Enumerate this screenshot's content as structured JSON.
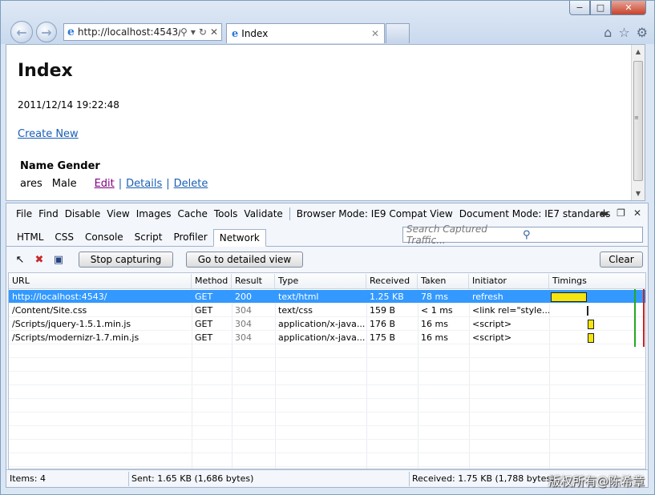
{
  "browser": {
    "address": "http://localhost:4543/",
    "tab_title": "Index",
    "window_controls": {
      "minimize": "−",
      "maximize": "□",
      "close": "✕"
    }
  },
  "page": {
    "title": "Index",
    "date": "2011/12/14 19:22:48",
    "create_link": "Create New",
    "table_header": "Name Gender",
    "row": {
      "name": "ares",
      "gender": "Male",
      "edit": "Edit",
      "details": "Details",
      "delete": "Delete",
      "sep": "|"
    }
  },
  "devtools": {
    "menu": [
      "File",
      "Find",
      "Disable",
      "View",
      "Images",
      "Cache",
      "Tools",
      "Validate"
    ],
    "browser_mode": "Browser Mode: IE9 Compat View",
    "document_mode": "Document Mode: IE7 standards",
    "tabs": [
      "HTML",
      "CSS",
      "Console",
      "Script",
      "Profiler",
      "Network"
    ],
    "active_tab": "Network",
    "search_placeholder": "Search Captured Traffic...",
    "buttons": {
      "stop": "Stop capturing",
      "detail": "Go to detailed view",
      "clear": "Clear"
    },
    "columns": [
      "URL",
      "Method",
      "Result",
      "Type",
      "Received",
      "Taken",
      "Initiator",
      "Timings"
    ],
    "rows": [
      {
        "url": "http://localhost:4543/",
        "method": "GET",
        "result": "200",
        "type": "text/html",
        "received": "1.25 KB",
        "taken": "78 ms",
        "initiator": "refresh",
        "t_start": 0.0,
        "t_len": 0.55
      },
      {
        "url": "/Content/Site.css",
        "method": "GET",
        "result": "304",
        "type": "text/css",
        "received": "159 B",
        "taken": "< 1 ms",
        "initiator": "<link rel=\"style...",
        "t_start": 0.55,
        "t_len": 0.02
      },
      {
        "url": "/Scripts/jquery-1.5.1.min.js",
        "method": "GET",
        "result": "304",
        "type": "application/x-java...",
        "received": "176 B",
        "taken": "16 ms",
        "initiator": "<script>",
        "t_start": 0.56,
        "t_len": 0.1
      },
      {
        "url": "/Scripts/modernizr-1.7.min.js",
        "method": "GET",
        "result": "304",
        "type": "application/x-java...",
        "received": "175 B",
        "taken": "16 ms",
        "initiator": "<script>",
        "t_start": 0.56,
        "t_len": 0.1
      }
    ],
    "status": {
      "items": "Items: 4",
      "sent": "Sent: 1.65 KB (1,686 bytes)",
      "received": "Received: 1.75 KB (1,788 bytes)"
    },
    "colors": {
      "selected_row": "#3399ff",
      "timing_bar": "#f4e40f",
      "dom_line": "#22aa22",
      "load_line": "#cc2222"
    }
  },
  "watermark": "版权所有@陈希章"
}
